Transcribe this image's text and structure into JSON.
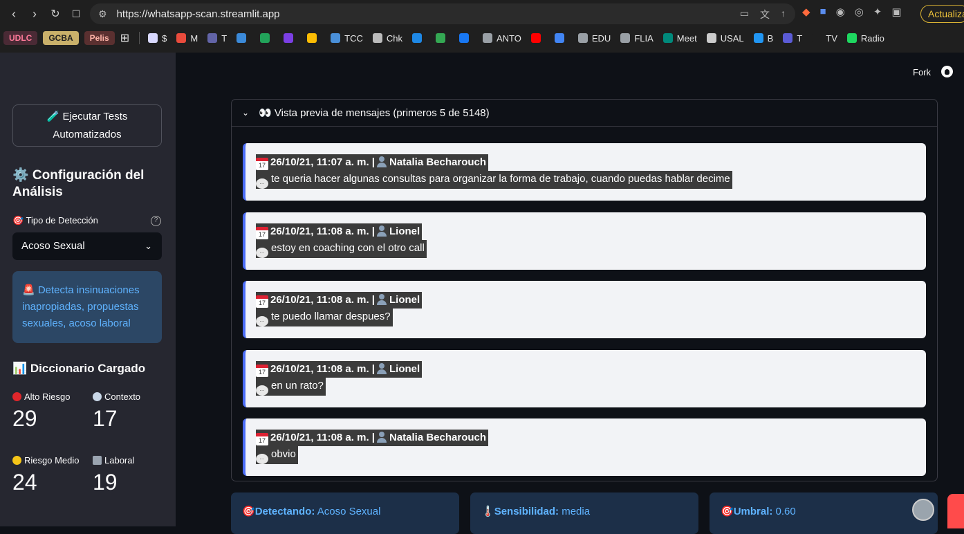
{
  "browser": {
    "url": "https://whatsapp-scan.streamlit.app",
    "update_label": "Actualizar",
    "bookmarks": [
      {
        "label": "UDLC",
        "color": "#ff7a9a",
        "bg": "#4a2a35",
        "tag": true
      },
      {
        "label": "GCBA",
        "color": "#1f1f1f",
        "bg": "#c9b06a",
        "tag": true
      },
      {
        "label": "Pelis",
        "color": "#ffb4a8",
        "bg": "#5a3030",
        "tag": true
      },
      {
        "label": "$",
        "icon": "#d9d9ff"
      },
      {
        "label": "M",
        "icon": "#e94b3c"
      },
      {
        "label": "T",
        "icon": "#6264a7"
      },
      {
        "label": "",
        "icon": "#3b8ad9"
      },
      {
        "label": "",
        "icon": "#22a35a"
      },
      {
        "label": "",
        "icon": "#7b3fe4"
      },
      {
        "label": "",
        "icon": "#fbbc04"
      },
      {
        "label": "TCC",
        "icon": "#4a90d9"
      },
      {
        "label": "Chk",
        "icon": "#bbbbbb"
      },
      {
        "label": "",
        "icon": "#1e88e5"
      },
      {
        "label": "",
        "icon": "#34a853"
      },
      {
        "label": "",
        "icon": "#1877f2"
      },
      {
        "label": "ANTO",
        "icon": "#9aa0a6"
      },
      {
        "label": "",
        "icon": "#ff0000"
      },
      {
        "label": "",
        "icon": "#4285f4"
      },
      {
        "label": "EDU",
        "icon": "#9aa0a6"
      },
      {
        "label": "FLIA",
        "icon": "#9aa0a6"
      },
      {
        "label": "Meet",
        "icon": "#00897b"
      },
      {
        "label": "USAL",
        "icon": "#cccccc"
      },
      {
        "label": "B",
        "icon": "#2196f3"
      },
      {
        "label": "T",
        "icon": "#5b5bd6"
      },
      {
        "label": "TV",
        "icon": "#1f1f1f"
      },
      {
        "label": "Radio",
        "icon": "#1ed760"
      }
    ]
  },
  "sidebar": {
    "tests_button": "🧪 Ejecutar Tests Automatizados",
    "config_title": "⚙️ Configuración del Análisis",
    "detection_label": "🎯 Tipo de Detección",
    "detection_value": "Acoso Sexual",
    "info_text": "🚨 Detecta insinuaciones inapropiadas, propuestas sexuales, acoso laboral",
    "dict_title": "📊 Diccionario Cargado",
    "metrics": [
      {
        "label": "Alto Riesgo",
        "value": "29",
        "icon": "red-circle-icon",
        "color": "#e0262b"
      },
      {
        "label": "Contexto",
        "value": "17",
        "icon": "magnifier-icon",
        "color": "#c8d6e6"
      },
      {
        "label": "Riesgo Medio",
        "value": "24",
        "icon": "yellow-circle-icon",
        "color": "#f5c518"
      },
      {
        "label": "Laboral",
        "value": "19",
        "icon": "office-building-icon",
        "color": "#9aa4b0"
      }
    ]
  },
  "header": {
    "fork_label": "Fork"
  },
  "preview": {
    "title": "👀 Vista previa de mensajes (primeros 5 de 5148)",
    "messages": [
      {
        "meta": "26/10/21, 11:07 a. m. |",
        "author": "Natalia Becharouch",
        "text": "te queria hacer algunas consultas para organizar la forma de trabajo, cuando puedas hablar decime"
      },
      {
        "meta": "26/10/21, 11:08 a. m. |",
        "author": "Lionel",
        "text": "estoy en coaching con el otro call"
      },
      {
        "meta": "26/10/21, 11:08 a. m. |",
        "author": "Lionel",
        "text": "te puedo llamar despues?"
      },
      {
        "meta": "26/10/21, 11:08 a. m. |",
        "author": "Lionel",
        "text": "en un rato?"
      },
      {
        "meta": "26/10/21, 11:08 a. m. |",
        "author": "Natalia Becharouch",
        "text": "obvio"
      }
    ]
  },
  "cards": [
    {
      "label": "Detectando:",
      "value": "Acoso Sexual",
      "prefix": "🎯"
    },
    {
      "label": "Sensibilidad:",
      "value": "media",
      "prefix": "🌡️"
    },
    {
      "label": "Umbral:",
      "value": "0.60",
      "prefix": "🎯"
    }
  ]
}
